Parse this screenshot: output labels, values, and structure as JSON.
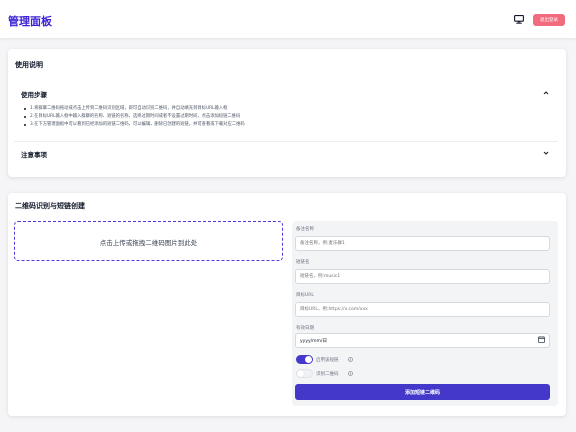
{
  "header": {
    "title": "管理面板",
    "monitor_icon": "monitor-icon",
    "exit_label": "退出登录",
    "exit_color": "#f26b7d"
  },
  "instructions": {
    "title": "使用说明",
    "steps_section": {
      "label": "使用步骤",
      "expanded": true,
      "items": [
        "1.将群聊二维码拖动或点击上传到二维码识别区域，即可自动识别二维码，并自动填充到目标URL输入框",
        "2.在目标URL输入框中输入群聊的名称、短链的名称，选择过期时间或者不设置过期时间，点击添加短链二维码",
        "3.在下方管理面板中可以看到已经添加的短链二维码，可以编辑，删除已创建的短链，并可查看或下载对应二维码"
      ]
    },
    "notes_section": {
      "label": "注意事项",
      "expanded": false
    }
  },
  "create": {
    "title": "二维码识别与短链创建",
    "upload_text": "点击上传或拖拽二维码图片到此处",
    "fields": {
      "group_name": {
        "label": "备注名称",
        "placeholder": "备注名称，例:麦乐群1"
      },
      "short_name": {
        "label": "短链名",
        "placeholder": "短链名，例:music1"
      },
      "target_url": {
        "label": "目标URL",
        "placeholder": "目标URL，例:https://x.com/xxx"
      },
      "expiry": {
        "label": "有效日期",
        "value": "yyyy/mm/日"
      }
    },
    "toggles": [
      {
        "label": "启用该短链",
        "on": true
      },
      {
        "label": "识别二维码",
        "on": false
      }
    ],
    "submit_label": "添加短链二维码",
    "accent_color": "#4338ca"
  }
}
